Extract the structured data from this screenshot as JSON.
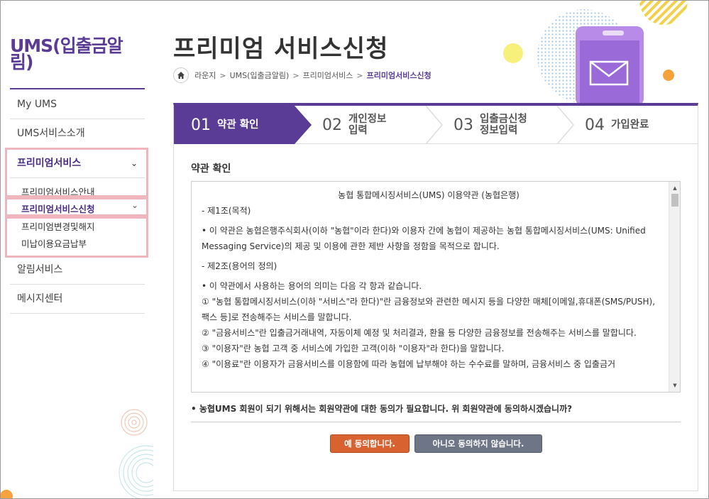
{
  "sidebar": {
    "app_title": "UMS(입출금알림)",
    "items": [
      {
        "label": "My UMS"
      },
      {
        "label": "UMS서비스소개"
      },
      {
        "label": "프리미엄서비스"
      },
      {
        "label": "알림서비스"
      },
      {
        "label": "메시지센터"
      }
    ],
    "sub_items": [
      {
        "label": "프리미엄서비스안내"
      },
      {
        "label": "프리미엄서비스신청"
      },
      {
        "label": "프리미엄변경및해지"
      },
      {
        "label": "미납이용요금납부"
      }
    ]
  },
  "header": {
    "page_title": "프리미엄 서비스신청",
    "breadcrumb": [
      "라운지",
      "UMS(입출금알림)",
      "프리미엄서비스",
      "프리미엄서비스신청"
    ]
  },
  "steps": [
    {
      "num": "01",
      "label": "약관 확인",
      "active": true
    },
    {
      "num": "02",
      "label": "개인정보\n입력",
      "active": false
    },
    {
      "num": "03",
      "label": "입출금신청\n정보입력",
      "active": false
    },
    {
      "num": "04",
      "label": "가입완료",
      "active": false
    }
  ],
  "main": {
    "section_title": "약관 확인",
    "terms_title": "농협 통합메시징서비스(UMS) 이용약관 (농협은행)",
    "terms": [
      "- 제1조(목적)",
      "• 이 약관은 농협은행주식회사(이하 \"농협\"이라 한다)와 이용자 간에 농협이 제공하는 농협 통합메시징서비스(UMS: Unified Messaging Service)의 제공 및 이용에 관한 제반 사항을 정함을 목적으로 합니다.",
      "- 제2조(용어의 정의)",
      "• 이 약관에서 사용하는 용어의 의미는 다음 각 항과 같습니다.",
      "① \"농협 통합메시징서비스(이하 \"서비스\"라 한다)\"란 금융정보와 관련한 메시지 등을 다양한 매체[이메일,휴대폰(SMS/PUSH),팩스 등]로 전송해주는 서비스를 말합니다.",
      "② \"금융서비스\"란 입출금거래내역, 자동이체 예정 및 처리결과, 환율 등 다양한 금융정보를 전송해주는 서비스를 말합니다.",
      "③ \"이용자\"란 농협 고객 중 서비스에 가입한 고객(이하 \"이용자\"라 한다)을 말합니다.",
      "④ \"이용료\"란 이용자가 금융서비스를 이용함에 따라 농협에 납부해야 하는 수수료를 말하며, 금융서비스 중 입출금거"
    ],
    "notice": "• 농협UMS 회원이 되기 위해서는 회원약관에 대한 동의가 필요합니다. 위 회원약관에 동의하시겠습니까?",
    "agree_label": "예 동의합니다.",
    "disagree_label": "아니오 동의하지 않습니다."
  },
  "colors": {
    "brand": "#5a3c96",
    "agree": "#d86230",
    "disagree": "#6e7586",
    "highlight": "#f1b6bd"
  },
  "icons": [
    "home-icon",
    "chevron-down-icon",
    "envelope-icon",
    "phone-icon"
  ]
}
